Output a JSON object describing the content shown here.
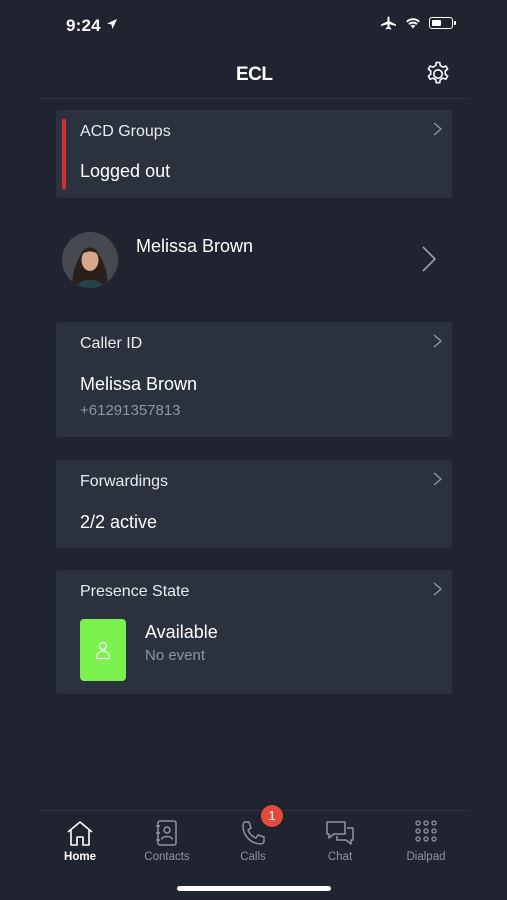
{
  "status_bar": {
    "time": "9:24"
  },
  "header": {
    "logo_text": "ECL"
  },
  "acd_groups": {
    "title": "ACD Groups",
    "value": "Logged out",
    "indicator_color": "#d0312d"
  },
  "profile": {
    "name": "Melissa Brown"
  },
  "caller_id": {
    "title": "Caller ID",
    "name": "Melissa Brown",
    "number": "+61291357813"
  },
  "forwardings": {
    "title": "Forwardings",
    "value": "2/2 active"
  },
  "presence": {
    "title": "Presence State",
    "state": "Available",
    "event": "No event",
    "state_color": "#7cf24f"
  },
  "tabs": [
    {
      "label": "Home",
      "icon": "home-icon",
      "active": true
    },
    {
      "label": "Contacts",
      "icon": "contacts-icon"
    },
    {
      "label": "Calls",
      "icon": "phone-icon",
      "badge": "1"
    },
    {
      "label": "Chat",
      "icon": "chat-icon"
    },
    {
      "label": "Dialpad",
      "icon": "dialpad-icon"
    }
  ],
  "colors": {
    "background": "#1f2430",
    "card": "#2b313d",
    "muted_text": "#8d95a3",
    "badge": "#e14b3e"
  }
}
